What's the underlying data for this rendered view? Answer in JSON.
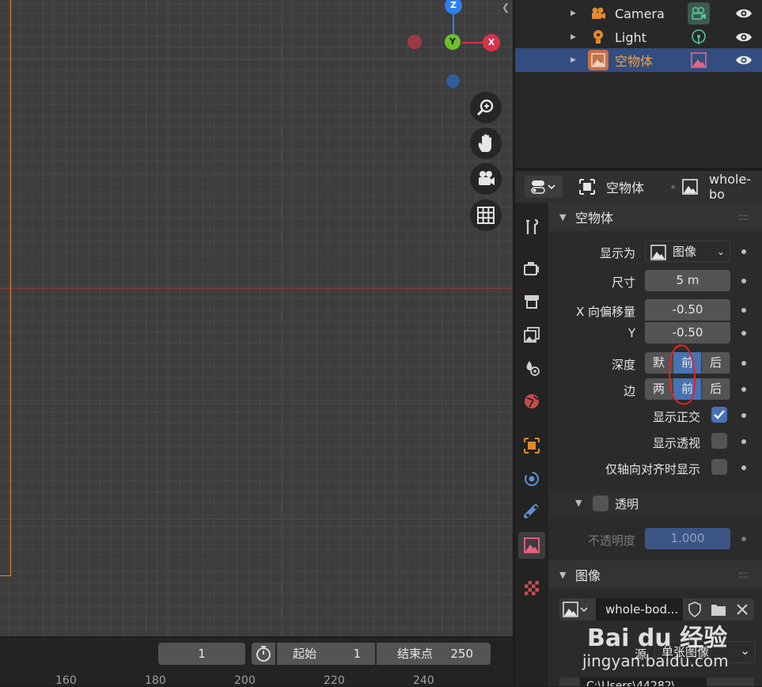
{
  "outliner": {
    "items": [
      {
        "label": "Camera",
        "color": "#e6e6e6"
      },
      {
        "label": "Light",
        "color": "#e6e6e6"
      },
      {
        "label": "空物体",
        "color": "#f0a24a"
      }
    ]
  },
  "props": {
    "header": {
      "object": "空物体",
      "data": "whole-bo"
    },
    "panel_empty": {
      "title": "空物体"
    },
    "display_as": {
      "label": "显示为",
      "value": "图像"
    },
    "size": {
      "label": "尺寸",
      "value": "5 m"
    },
    "offset_x": {
      "label": "X 向偏移量",
      "value": "-0.50"
    },
    "offset_y": {
      "label": "Y",
      "value": "-0.50"
    },
    "depth": {
      "label": "深度",
      "options": [
        "默",
        "前",
        "后"
      ],
      "selected": 1
    },
    "side": {
      "label": "边",
      "options": [
        "两",
        "前",
        "后"
      ],
      "selected": 1
    },
    "show_ortho": {
      "label": "显示正交",
      "checked": true
    },
    "show_persp": {
      "label": "显示透视",
      "checked": false
    },
    "axis_aligned": {
      "label": "仅轴向对齐时显示",
      "checked": false
    },
    "transparency": {
      "label": "透明",
      "checked": false
    },
    "opacity": {
      "label": "不透明度",
      "value": "1.000"
    },
    "panel_image": {
      "title": "图像"
    },
    "image_name": "whole-bod...",
    "source": {
      "label": "源",
      "value": "单张图像"
    },
    "filepath": "C:\\Users\\44282\\"
  },
  "gizmo": {
    "x": "X",
    "y": "Y",
    "z": "Z"
  },
  "timeline": {
    "current": "1",
    "start_label": "起始",
    "start": "1",
    "end_label": "结束点",
    "end": "250",
    "ruler": [
      "160",
      "180",
      "200",
      "220",
      "240"
    ]
  },
  "watermark": {
    "brand": "Bai du 经验",
    "url": "jingyan.baidu.com"
  },
  "colors": {
    "accent": "#4772b3",
    "selection": "#e08b2e",
    "x_axis": "#d9314a",
    "y_axis": "#6fbf2a",
    "z_axis": "#2f80ed"
  }
}
